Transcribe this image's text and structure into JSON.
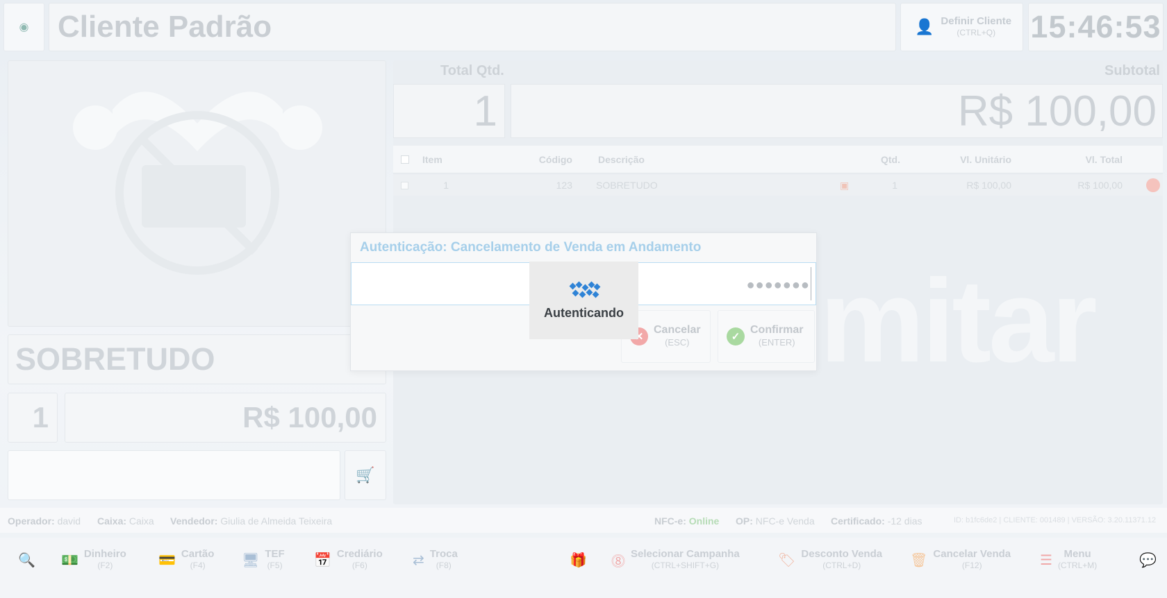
{
  "header": {
    "client_name": "Cliente Padrão",
    "define_client_label": "Definir Cliente",
    "define_client_shortcut": "(CTRL+Q)",
    "clock": "15:46:53"
  },
  "product": {
    "name": "SOBRETUDO",
    "quantity": "1",
    "price": "R$ 100,00",
    "barcode_value": ""
  },
  "totals": {
    "qty_label": "Total Qtd.",
    "qty_value": "1",
    "subtotal_label": "Subtotal",
    "subtotal_value": "R$ 100,00"
  },
  "table": {
    "headers": [
      "Item",
      "Código",
      "Descrição",
      "Qtd.",
      "Vl. Unitário",
      "Vl. Total"
    ],
    "rows": [
      {
        "item": "1",
        "codigo": "123",
        "descricao": "SOBRETUDO",
        "qtd": "1",
        "unit": "R$ 100,00",
        "total": "R$ 100,00"
      }
    ]
  },
  "watermark": "mitar",
  "status": {
    "operator_label": "Operador:",
    "operator_value": "david",
    "caixa_label": "Caixa:",
    "caixa_value": "Caixa",
    "seller_label": "Vendedor:",
    "seller_value": "Giulia de Almeida Teixeira",
    "nfce_label": "NFC-e:",
    "nfce_value": "Online",
    "op_label": "OP:",
    "op_value": "NFC-e Venda",
    "cert_label": "Certificado:",
    "cert_value": "-12 dias",
    "version": "ID: b1fc6de2 | CLIENTE: 001489 | VERSÃO: 3.20.11371.12"
  },
  "toolbar": {
    "dinheiro": {
      "label": "Dinheiro",
      "key": "(F2)"
    },
    "cartao": {
      "label": "Cartão",
      "key": "(F4)"
    },
    "tef": {
      "label": "TEF",
      "key": "(F5)"
    },
    "crediario": {
      "label": "Crediário",
      "key": "(F6)"
    },
    "troca": {
      "label": "Troca",
      "key": "(F8)"
    },
    "campanha": {
      "label": "Selecionar Campanha",
      "key": "(CTRL+SHIFT+G)"
    },
    "desconto": {
      "label": "Desconto Venda",
      "key": "(CTRL+D)"
    },
    "cancelar": {
      "label": "Cancelar Venda",
      "key": "(F12)"
    },
    "menu": {
      "label": "Menu",
      "key": "(CTRL+M)"
    }
  },
  "dialog": {
    "title": "Autenticação: Cancelamento de Venda em Andamento",
    "password_mask": "●●●●●●●",
    "cancel_label": "Cancelar",
    "cancel_key": "(ESC)",
    "confirm_label": "Confirmar",
    "confirm_key": "(ENTER)",
    "loading_text": "Autenticando"
  },
  "colors": {
    "accent_blue": "#2f83d6",
    "dialog_title": "#a6cfea",
    "online": "#b6dcb6",
    "cancel_red": "#f2a8a8",
    "confirm_green": "#a9d9a0"
  }
}
